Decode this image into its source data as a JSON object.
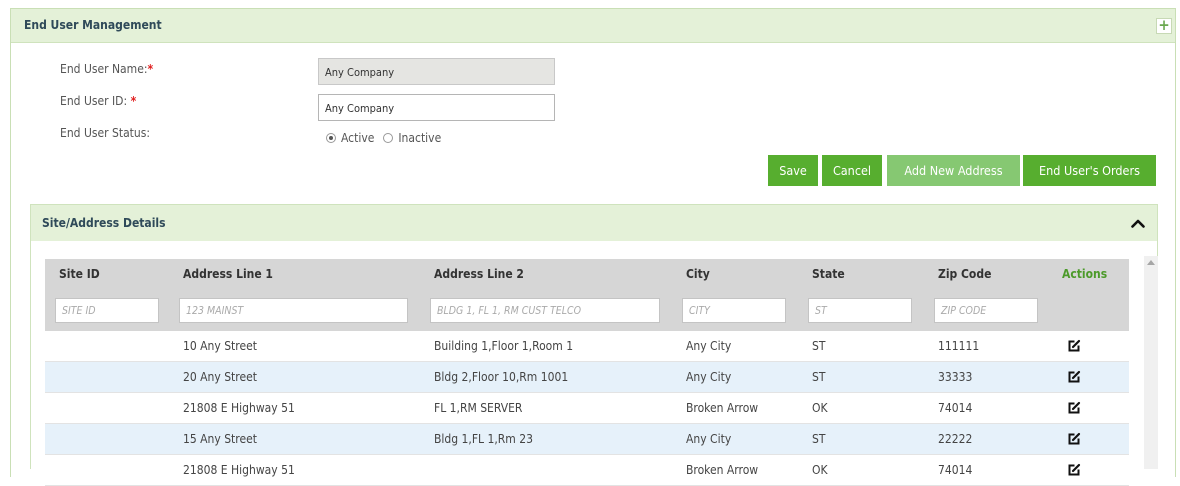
{
  "panel": {
    "title": "End User Management"
  },
  "form": {
    "name_label": "End User Name:",
    "id_label": "End User ID:",
    "required_mark": "*",
    "status_label": "End User Status:",
    "name_value": "Any Company",
    "id_value": "Any Company",
    "status_active": "Active",
    "status_inactive": "Inactive",
    "status_selected": "Active"
  },
  "buttons": {
    "save": "Save",
    "cancel": "Cancel",
    "add_address": "Add New Address",
    "orders": "End User's Orders"
  },
  "site_panel": {
    "title": "Site/Address Details"
  },
  "table": {
    "columns": [
      "Site ID",
      "Address Line 1",
      "Address Line 2",
      "City",
      "State",
      "Zip Code",
      "Actions"
    ],
    "filters": [
      "SITE ID",
      "123 MAINST",
      "BLDG 1, FL 1, RM CUST TELCO",
      "CITY",
      "ST",
      "ZIP CODE"
    ],
    "rows": [
      [
        "",
        "10 Any Street",
        "Building 1,Floor 1,Room 1",
        "Any City",
        "ST",
        "111111"
      ],
      [
        "",
        "20 Any Street",
        "Bldg 2,Floor 10,Rm 1001",
        "Any City",
        "ST",
        "33333"
      ],
      [
        "",
        "21808 E Highway 51",
        "FL 1,RM SERVER",
        "Broken Arrow",
        "OK",
        "74014"
      ],
      [
        "",
        "15 Any Street",
        "Bldg 1,FL 1,Rm 23",
        "Any City",
        "ST",
        "22222"
      ],
      [
        "",
        "21808 E Highway 51",
        "",
        "Broken Arrow",
        "OK",
        "74014"
      ]
    ]
  },
  "colors": {
    "accent": "#57ae2f",
    "header_bg": "#e4f1d8",
    "alt_row": "#e6f1fa"
  },
  "icons": {
    "expand": "plus-icon",
    "collapse": "chevron-up-icon",
    "edit": "edit-icon"
  }
}
